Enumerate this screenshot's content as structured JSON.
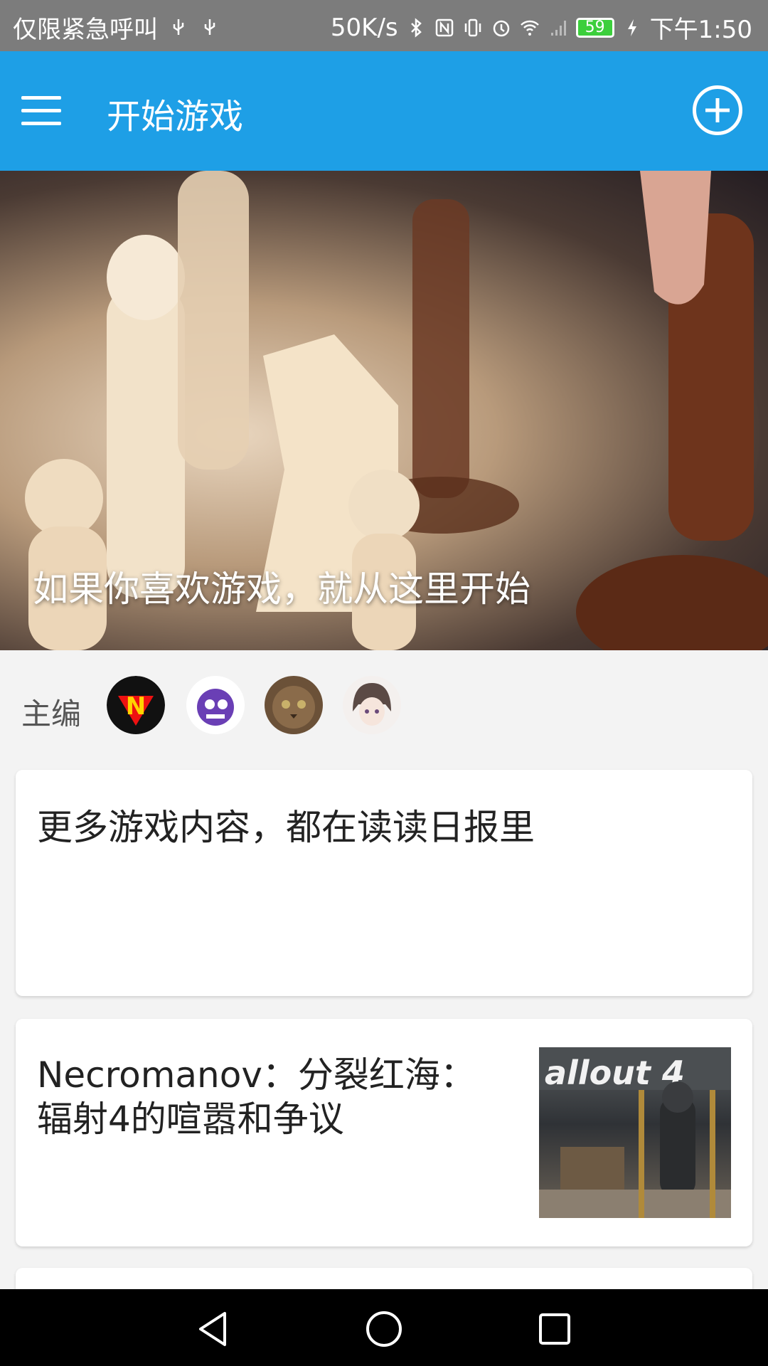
{
  "status_bar": {
    "carrier": "仅限紧急呼叫",
    "speed": "50K/s",
    "battery": "59",
    "time": "下午1:50"
  },
  "app_bar": {
    "title": "开始游戏"
  },
  "hero": {
    "caption": "如果你喜欢游戏，就从这里开始"
  },
  "editors": {
    "label": "主编",
    "avatars": [
      "avatar-n-logo",
      "avatar-purple-creature",
      "avatar-cat",
      "avatar-anime-girl"
    ]
  },
  "cards": [
    {
      "title": "更多游戏内容，都在读读日报里"
    },
    {
      "title": "Necromanov：分裂红海：辐射4的喧嚣和争议",
      "thumbnail_text": "allout 4"
    }
  ],
  "colors": {
    "app_bar": "#1e9fe6",
    "status_bar": "#7c7c7c",
    "background": "#f3f3f3"
  }
}
